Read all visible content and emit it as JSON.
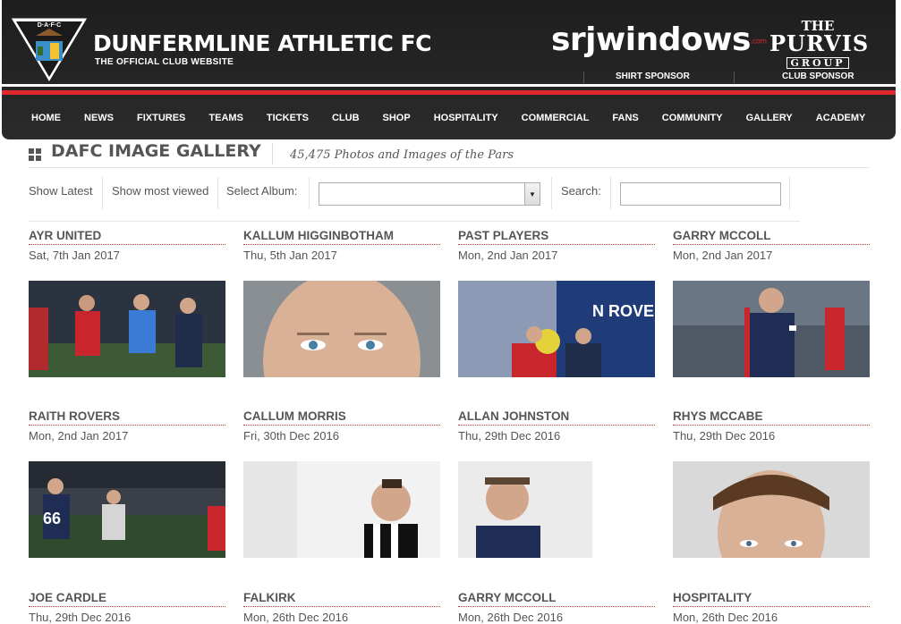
{
  "header": {
    "crest_text": "D·A·F·C",
    "brand_name": "DUNFERMLINE ATHLETIC FC",
    "brand_tagline": "THE OFFICIAL CLUB WEBSITE",
    "shirt_sponsor_name": "srjwindows",
    "shirt_sponsor_suffix": ".com",
    "shirt_sponsor_label": "SHIRT SPONSOR",
    "club_sponsor_line1": "THE",
    "club_sponsor_line2": "PURVIS",
    "club_sponsor_line3": "GROUP",
    "club_sponsor_label": "CLUB SPONSOR"
  },
  "nav": {
    "items": [
      "HOME",
      "NEWS",
      "FIXTURES",
      "TEAMS",
      "TICKETS",
      "CLUB",
      "SHOP",
      "HOSPITALITY",
      "COMMERCIAL",
      "FANS",
      "COMMUNITY",
      "GALLERY",
      "ACADEMY"
    ]
  },
  "gallery": {
    "title": "DAFC IMAGE GALLERY",
    "subtitle": "45,475 Photos and Images of the Pars"
  },
  "toolbar": {
    "show_latest": "Show Latest",
    "show_most_viewed": "Show most viewed",
    "select_album_label": "Select Album:",
    "album_value": "",
    "search_label": "Search:",
    "search_value": ""
  },
  "albums": [
    {
      "title": "AYR UNITED",
      "date": "Sat, 7th Jan 2017"
    },
    {
      "title": "KALLUM HIGGINBOTHAM",
      "date": "Thu, 5th Jan 2017"
    },
    {
      "title": "PAST PLAYERS",
      "date": "Mon, 2nd Jan 2017"
    },
    {
      "title": "GARRY MCCOLL",
      "date": "Mon, 2nd Jan 2017"
    },
    {
      "title": "RAITH ROVERS",
      "date": "Mon, 2nd Jan 2017"
    },
    {
      "title": "CALLUM MORRIS",
      "date": "Fri, 30th Dec 2016"
    },
    {
      "title": "ALLAN JOHNSTON",
      "date": "Thu, 29th Dec 2016"
    },
    {
      "title": "RHYS MCCABE",
      "date": "Thu, 29th Dec 2016"
    },
    {
      "title": "JOE CARDLE",
      "date": "Thu, 29th Dec 2016"
    },
    {
      "title": "FALKIRK",
      "date": "Mon, 26th Dec 2016"
    },
    {
      "title": "GARRY MCCOLL",
      "date": "Mon, 26th Dec 2016"
    },
    {
      "title": "HOSPITALITY",
      "date": "Mon, 26th Dec 2016"
    }
  ],
  "colors": {
    "header_bg": "#1e1e1e",
    "accent_red": "#e2282f",
    "text_grey": "#555555"
  }
}
